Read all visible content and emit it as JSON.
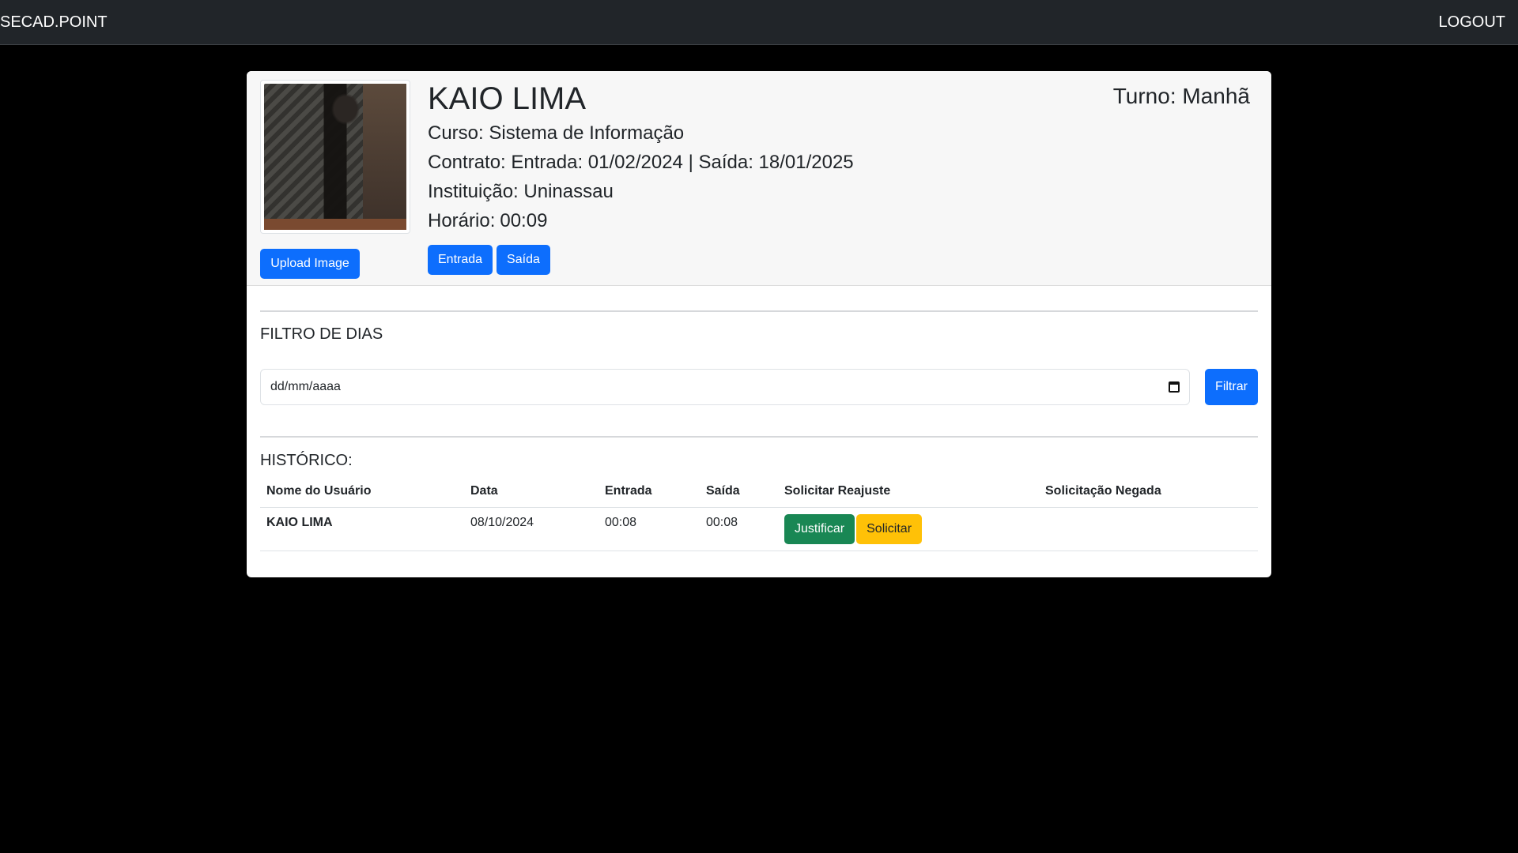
{
  "navbar": {
    "brand": "SECAD.POINT",
    "logout": "LOGOUT"
  },
  "profile": {
    "name": "KAIO LIMA",
    "curso": "Curso: Sistema de Informação",
    "contrato": "Contrato: Entrada: 01/02/2024 | Saída: 18/01/2025",
    "instituicao": "Instituição: Uninassau",
    "horario_label": "Horário:",
    "horario_value": "00:09",
    "turno": "Turno: Manhã",
    "upload_label": "Upload Image",
    "entrada_label": "Entrada",
    "saida_label": "Saída"
  },
  "filter": {
    "title": "FILTRO DE DIAS",
    "placeholder": "dd/mm/aaaa",
    "button": "Filtrar"
  },
  "history": {
    "title": "HISTÓRICO:",
    "columns": [
      "Nome do Usuário",
      "Data",
      "Entrada",
      "Saída",
      "Solicitar Reajuste",
      "Solicitação Negada"
    ],
    "rows": [
      {
        "nome": "KAIO LIMA",
        "data": "08/10/2024",
        "entrada": "00:08",
        "saida": "00:08",
        "justificar": "Justificar",
        "solicitar": "Solicitar",
        "negada": ""
      }
    ]
  },
  "colors": {
    "primary": "#0d6efd",
    "success": "#198754",
    "warning": "#ffc107",
    "navbar": "#212529",
    "background": "#000000"
  }
}
